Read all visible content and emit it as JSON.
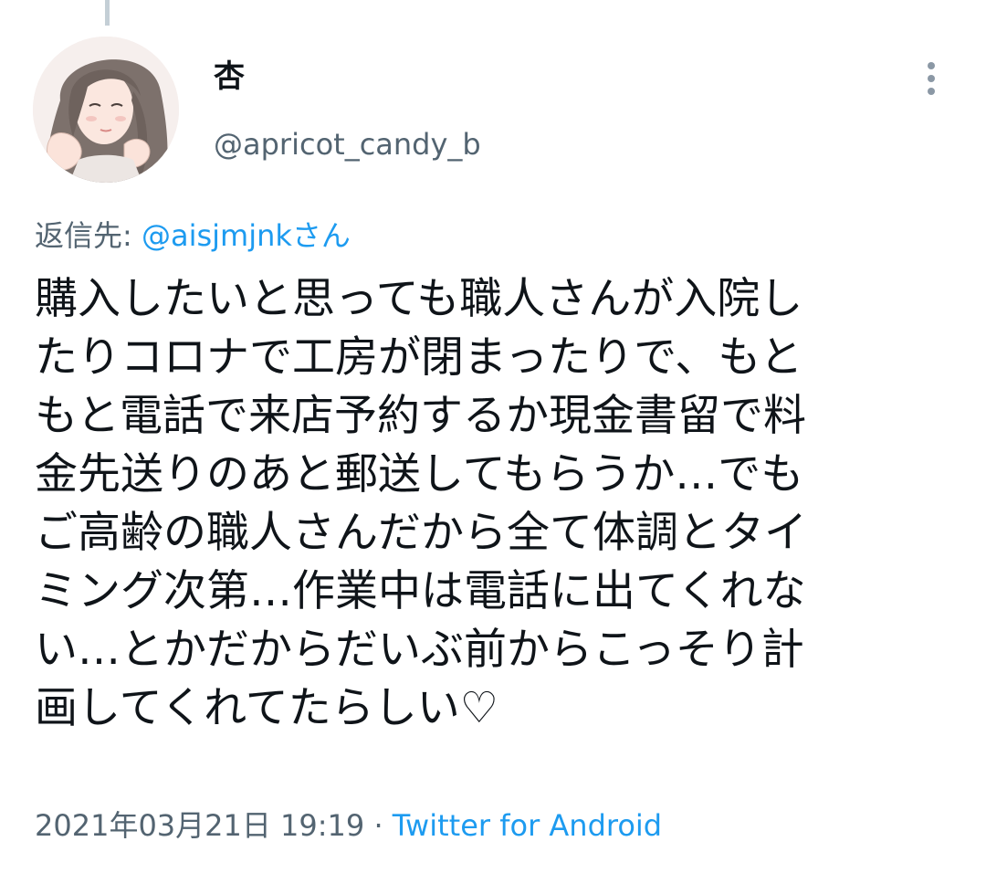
{
  "tweet": {
    "author": {
      "display_name": "杏",
      "handle": "@apricot_candy_b",
      "avatar_icon": "avatar-illustration"
    },
    "more_icon": "more-vertical-icon",
    "reply_to": {
      "prefix": "返信先: ",
      "mention": "@aisjmjnkさん"
    },
    "text_lines": [
      "購入したいと思っても職人さんが入院し",
      "たりコロナで工房が閉まったりで、もと",
      "もと電話で来店予約するか現金書留で料",
      "金先送りのあと郵送してもらうか…でも",
      "ご高齢の職人さんだから全て体調とタイ",
      "ミング次第…作業中は電話に出てくれな",
      "い…とかだからだいぶ前からこっそり計",
      "画してくれてたらしい♡"
    ],
    "timestamp": "2021年03月21日 19:19",
    "separator": " · ",
    "source": "Twitter for Android"
  },
  "colors": {
    "text_primary": "#0f1419",
    "text_secondary": "#536471",
    "accent": "#1d9bf0",
    "thread_line": "#c4cfd6"
  }
}
